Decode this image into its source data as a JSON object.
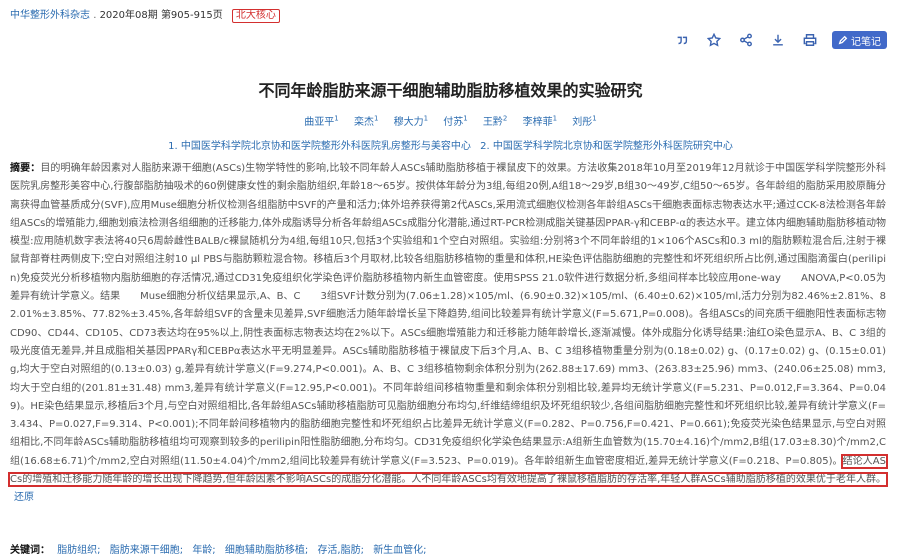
{
  "header": {
    "journal": "中华整形外科杂志",
    "issue": "2020年08期",
    "pages": "第905-915页",
    "badge": "北大核心"
  },
  "toolbar": {
    "icons": [
      "quote-icon",
      "star-icon",
      "share-icon",
      "download-icon",
      "print-icon"
    ],
    "note_label": "记笔记"
  },
  "article": {
    "title": "不同年龄脂肪来源干细胞辅助脂肪移植效果的实验研究",
    "authors": [
      {
        "name": "曲亚平",
        "sup": "1"
      },
      {
        "name": "栾杰",
        "sup": "1"
      },
      {
        "name": "穆大力",
        "sup": "1"
      },
      {
        "name": "付苏",
        "sup": "1"
      },
      {
        "name": "王黔",
        "sup": "2"
      },
      {
        "name": "李梓菲",
        "sup": "1"
      },
      {
        "name": "刘彤",
        "sup": "1"
      }
    ],
    "affiliations": [
      "1. 中国医学科学院北京协和医学院整形外科医院乳房整形与美容中心",
      "2. 中国医学科学院北京协和医学院整形外科医院研究中心"
    ],
    "abstract_label": "摘要：",
    "abstract_text": "目的明确年龄因素对人脂肪来源干细胞(ASCs)生物学特性的影响,比较不同年龄人ASCs辅助脂肪移植于裸鼠皮下的效果。方法收集2018年10月至2019年12月就诊于中国医学科学院整形外科医院乳房整形美容中心,行腹部脂肪抽吸术的60例健康女性的剩余脂肪组织,年龄18～65岁。按供体年龄分为3组,每组20例,A组18～29岁,B组30～49岁,C组50～65岁。各年龄组的脂肪采用胶原酶分离获得血管基质成分(SVF),应用Muse细胞分析仪检测各组脂肪中SVF的产量和活力;体外培养获得第2代ASCs,采用流式细胞仪检测各年龄组ASCs干细胞表面标志物表达水平;通过CCK-8法检测各年龄组ASCs的增殖能力,细胞划痕法检测各组细胞的迁移能力,体外成脂诱导分析各年龄组ASCs成脂分化潜能,通过RT-PCR检测成脂关键基因PPAR-γ和CEBP-α的表达水平。建立体内细胞辅助脂肪移植动物模型:应用随机数字表法将40只6周龄雌性BALB/c裸鼠随机分为4组,每组10只,包括3个实验组和1个空白对照组。实验组:分别将3个不同年龄组的1×106个ASCs和0.3 ml的脂肪颗粒混合后,注射于裸鼠背部脊柱两侧皮下;空白对照组注射10 μl PBS与脂肪颗粒混合物。移植后3个月取材,比较各组脂肪移植物的重量和体积,HE染色评估脂肪细胞的完整性和坏死组织所占比例,通过围脂滴蛋白(perilipin)免疫荧光分析移植物内脂肪细胞的存活情况,通过CD31免疫组织化学染色评价脂肪移植物内新生血管密度。使用SPSS 21.0软件进行数据分析,多组间样本比较应用one-way　　ANOVA,P<0.05为差异有统计学意义。结果　　Muse细胞分析仪结果显示,A、B、C　　3组SVF计数分别为(7.06±1.28)×105/ml、(6.90±0.32)×105/ml、(6.40±0.62)×105/ml,活力分别为82.46%±2.81%、82.01%±3.85%、77.82%±3.45%,各年龄组SVF的含量未见差异,SVF细胞活力随年龄增长呈下降趋势,组间比较差异有统计学意义(F=5.671,P=0.008)。各组ASCs的间充质干细胞阳性表面标志物CD90、CD44、CD105、CD73表达均在95%以上,阴性表面标志物表达均在2%以下。ASCs细胞增殖能力和迁移能力随年龄增长,逐渐减慢。体外成脂分化诱导结果:油红O染色显示A、B、C 3组的吸光度值无差异,并且成脂相关基因PPARγ和CEBPα表达水平无明显差异。ASCs辅助脂肪移植于裸鼠皮下后3个月,A、B、C 3组移植物重量分别为(0.18±0.02) g、(0.17±0.02) g、(0.15±0.01) g,均大于空白对照组的(0.13±0.03) g,差异有统计学意义(F=9.274,P<0.001)。A、B、C 3组移植物剩余体积分别为(262.88±17.69) mm3、(263.83±25.96) mm3、(240.06±25.08) mm3,均大于空白组的(201.81±31.48) mm3,差异有统计学意义(F=12.95,P<0.001)。不同年龄组间移植物重量和剩余体积分别相比较,差异均无统计学意义(F=5.231、P=0.012,F=3.364、P=0.049)。HE染色结果显示,移植后3个月,与空白对照组相比,各年龄组ASCs辅助移植脂肪可见脂肪细胞分布均匀,纤维结缔组织及坏死组织较少,各组间脂肪细胞完整性和坏死组织比较,差异有统计学意义(F=3.434、P=0.027,F=9.314、P<0.001);不同年龄间移植物内的脂肪细胞完整性和坏死组织占比差异无统计学意义(F=0.282、P=0.756,F=0.421、P=0.661);免疫荧光染色结果显示,与空白对照组相比,不同年龄ASCs辅助脂肪移植组均可观察到较多的perilipin阳性脂肪细胞,分布均匀。CD31免疫组织化学染色结果显示:A组新生血管数为(15.70±4.16)个/mm2,B组(17.03±8.30)个/mm2,C组(16.68±6.71)个/mm2,空白对照组(11.50±4.04)个/mm2,组间比较差异有统计学意义(F=3.523、P=0.019)。各年龄组新生血管密度相近,差异无统计学意义(F=0.218、P=0.805)。",
    "abstract_conclusion": "结论人ASCs的增殖和迁移能力随年龄的增长出现下降趋势,但年龄因素不影响ASCs的成脂分化潜能。人不同年龄ASCs均有效地提高了裸鼠移植脂肪的存活率,年轻人群ASCs辅助脂肪移植的效果优于老年人群。",
    "restore_label": "还原",
    "keywords_label": "关键词：",
    "keywords": [
      "脂肪组织;",
      "脂肪来源干细胞;",
      "年龄;",
      "细胞辅助脂肪移植;",
      "存活,脂肪;",
      "新生血管化;"
    ]
  }
}
